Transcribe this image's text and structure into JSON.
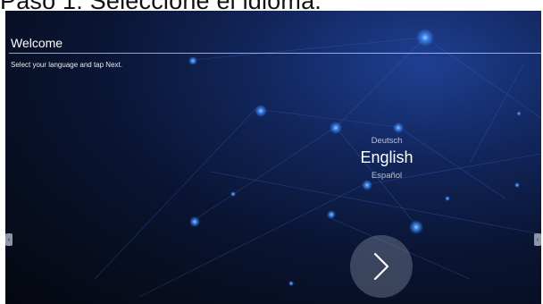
{
  "document": {
    "heading": "Paso 1: Seleccione el idioma."
  },
  "screen": {
    "title": "Welcome",
    "subtitle": "Select your language and tap Next.",
    "languages": {
      "above": "Deutsch",
      "selected": "English",
      "below": "Español"
    },
    "icons": {
      "next": "chevron-right-icon",
      "left_handle": "chevron-left-icon",
      "right_handle": "chevron-left-icon"
    },
    "colors": {
      "background": "#0a1534",
      "accent_blue": "#3d8dff",
      "text": "#ffffff"
    }
  }
}
